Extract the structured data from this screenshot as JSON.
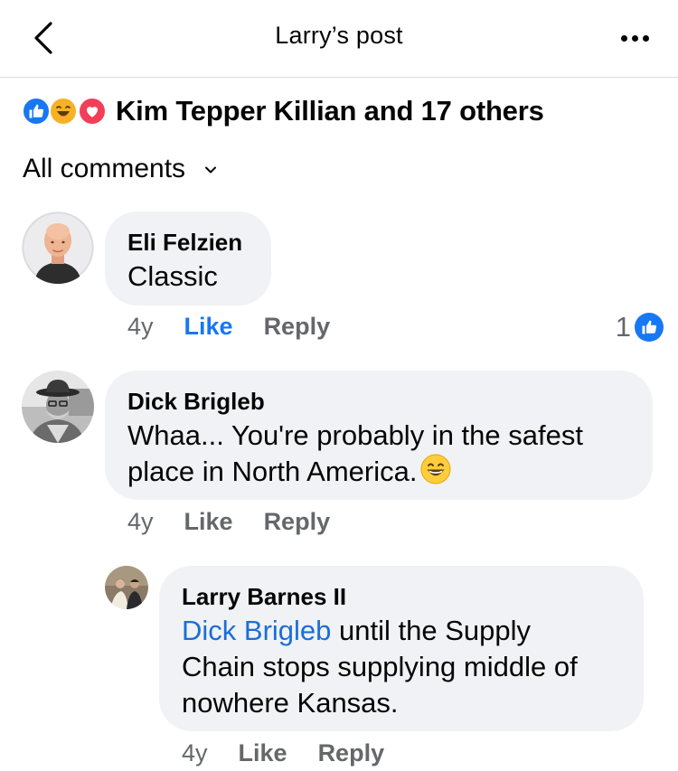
{
  "header": {
    "title": "Larry’s post"
  },
  "reactions": {
    "summary": "Kim Tepper Killian and 17 others",
    "types": [
      "like",
      "haha",
      "love"
    ]
  },
  "filter": {
    "label": "All comments"
  },
  "comments": [
    {
      "author": "Eli Felzien",
      "text": "Classic",
      "time": "4y",
      "like_label": "Like",
      "reply_label": "Reply",
      "liked": true,
      "like_count": "1"
    },
    {
      "author": "Dick Brigleb",
      "text_line1": "Whaa... You're probably in the safest",
      "text_line2": "place in North America.",
      "emoji": "grinning-face-smiling-eyes",
      "time": "4y",
      "like_label": "Like",
      "reply_label": "Reply",
      "liked": false
    },
    {
      "author": "Larry Barnes II",
      "mention": "Dick Brigleb",
      "text_line1": " until the Supply",
      "text_line2": "Chain stops supplying middle of",
      "text_line3": "nowhere Kansas.",
      "time": "4y",
      "like_label": "Like",
      "reply_label": "Reply",
      "liked": false
    }
  ],
  "colors": {
    "accent": "#1877f2",
    "mention": "#1a6ed8",
    "bubble": "#f0f2f5",
    "muted": "#65676b"
  }
}
